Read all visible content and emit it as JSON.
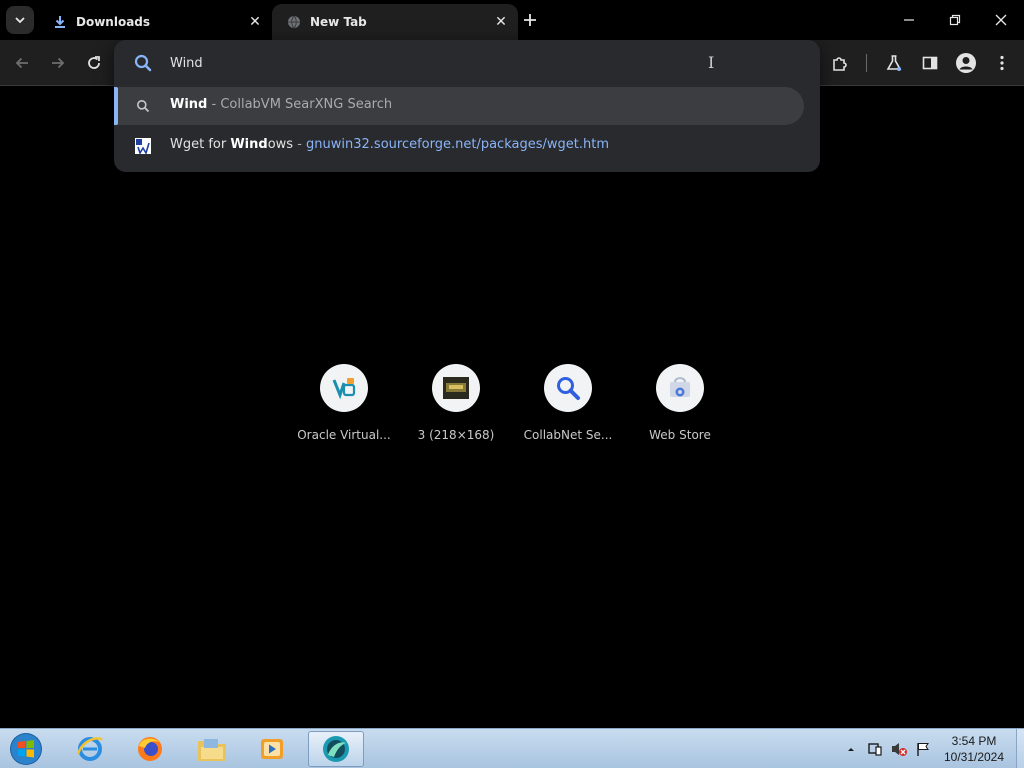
{
  "tabs": [
    {
      "title": "Downloads",
      "icon": "download-icon",
      "active": false
    },
    {
      "title": "New Tab",
      "icon": "globe-icon",
      "active": true
    }
  ],
  "omnibox": {
    "value": "Wind",
    "suggestions": [
      {
        "bold": "Wind",
        "rest": "",
        "separator": " - ",
        "source": "CollabVM SearXNG Search",
        "icon": "search-icon"
      },
      {
        "prefix": "Wget for ",
        "bold": "Wind",
        "rest": "ows",
        "separator": " - ",
        "source": "gnuwin32.sourceforge.net/packages/wget.htm",
        "icon": "site-favicon"
      }
    ]
  },
  "shortcuts": [
    {
      "label": "Oracle Virtual...",
      "icon": "virtualbox-icon"
    },
    {
      "label": "3 (218×168)",
      "icon": "image-thumbnail-icon"
    },
    {
      "label": "CollabNet Se...",
      "icon": "magnifier-icon"
    },
    {
      "label": "Web Store",
      "icon": "web-store-icon"
    }
  ],
  "taskbar": {
    "apps": [
      "internet-explorer-icon",
      "firefox-icon",
      "file-explorer-icon",
      "media-player-icon",
      "browser-icon"
    ],
    "time": "3:54 PM",
    "date": "10/31/2024"
  },
  "colors": {
    "accent": "#8ab4f8",
    "omnibox_bg": "#282a2d",
    "selected_row": "#3b3d40"
  }
}
